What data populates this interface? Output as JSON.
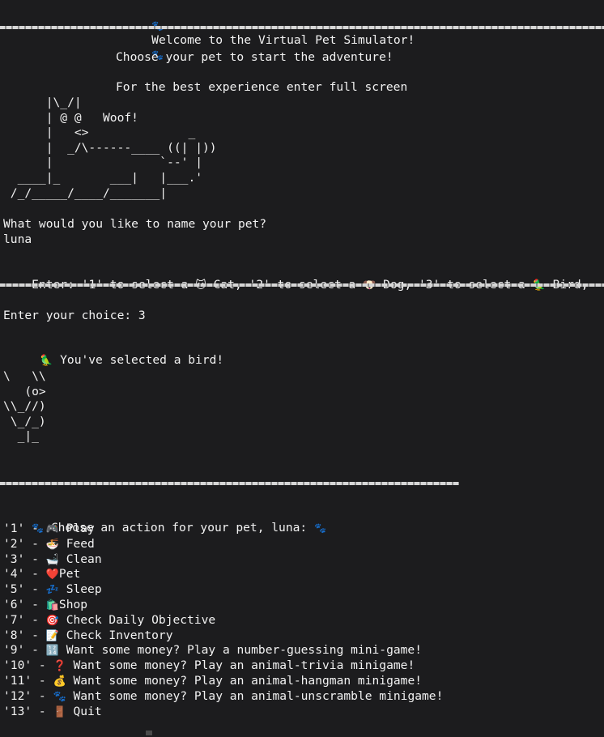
{
  "header": {
    "paw_left": "🐾",
    "title": "Welcome to the Virtual Pet Simulator!",
    "paw_right": "🐾"
  },
  "intro": {
    "line1": "Choose your pet to start the adventure!",
    "line2": "For the best experience enter full screen"
  },
  "dog_art": "      |\\_/|\n      | @ @   Woof!\n      |   <>              _\n      |  _/\\------____ ((| |))\n      |               `--' |\n  ____|_       ___|   |___.'\n /_/_____/____/_______|",
  "name_prompt": {
    "question": "What would you like to name your pet?",
    "answer": "luna"
  },
  "select_prompt": {
    "prefix": "Enter: '1' to select a ",
    "cat_emoji": "🐱",
    "cat_text": " Cat, '2' to select a ",
    "dog_emoji": "🐶",
    "dog_text": " Dog, '3' to select a ",
    "bird_emoji": "🦜",
    "bird_text": " Bird,"
  },
  "choice": {
    "label": "Enter your choice: 3"
  },
  "selected": {
    "emoji": "🦜",
    "text": " You've selected a bird!"
  },
  "bird_art": "\\   \\\\\n   (o>\n\\\\_//)\n \\_/_)\n  _|_",
  "menu": {
    "header_paw_left": "🐾",
    "header": " Choose an action for your pet, luna: ",
    "header_paw_right": "🐾",
    "items": [
      {
        "key": "'1' - ",
        "emoji": "🎮",
        "label": " Play"
      },
      {
        "key": "'2' - ",
        "emoji": "🍜",
        "label": " Feed"
      },
      {
        "key": "'3' - ",
        "emoji": "🛁",
        "label": " Clean"
      },
      {
        "key": "'4' - ",
        "emoji": "❤️",
        "label": "Pet"
      },
      {
        "key": "'5' - ",
        "emoji": "💤",
        "label": " Sleep"
      },
      {
        "key": "'6' - ",
        "emoji": "🛍️",
        "label": "Shop"
      },
      {
        "key": "'7' - ",
        "emoji": "🎯",
        "label": " Check Daily Objective"
      },
      {
        "key": "'8' - ",
        "emoji": "📝",
        "label": " Check Inventory"
      },
      {
        "key": "'9' - ",
        "emoji": "🔢",
        "label": " Want some money? Play a number-guessing mini-game!"
      },
      {
        "key": "'10' - ",
        "emoji": "❓",
        "label": " Want some money? Play an animal-trivia minigame!"
      },
      {
        "key": "'11' - ",
        "emoji": "💰",
        "label": " Want some money? Play an animal-hangman minigame!"
      },
      {
        "key": "'12' - ",
        "emoji": "🐾",
        "label": " Want some money? Play an animal-unscramble minigame!"
      },
      {
        "key": "'13' - ",
        "emoji": "🚪",
        "label": " Quit"
      }
    ]
  }
}
